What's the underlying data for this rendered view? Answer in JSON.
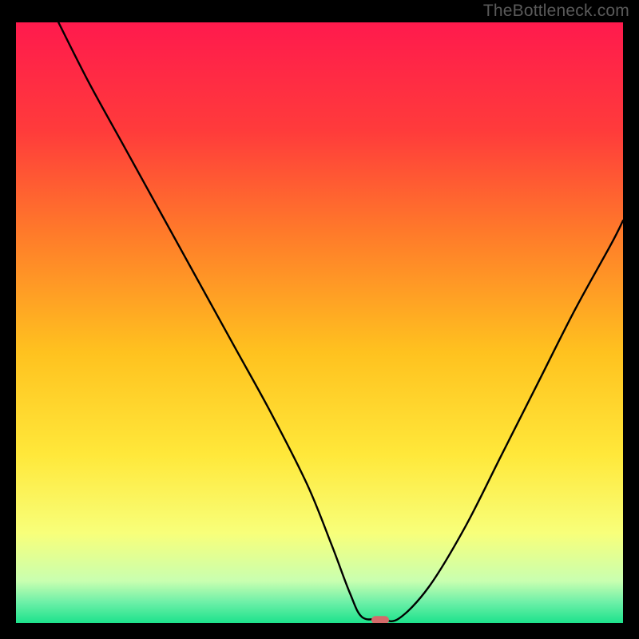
{
  "watermark": "TheBottleneck.com",
  "chart_data": {
    "type": "line",
    "title": "",
    "xlabel": "",
    "ylabel": "",
    "xlim": [
      0,
      100
    ],
    "ylim": [
      0,
      100
    ],
    "grid": false,
    "legend": false,
    "series": [
      {
        "name": "bottleneck-curve",
        "x": [
          7,
          12,
          18,
          24,
          30,
          36,
          42,
          48,
          52,
          55,
          57,
          60,
          63,
          68,
          74,
          80,
          86,
          92,
          98,
          100
        ],
        "values": [
          100,
          90,
          79,
          68,
          57,
          46,
          35,
          23,
          13,
          5,
          1,
          0.7,
          0.7,
          6,
          16,
          28,
          40,
          52,
          63,
          67
        ],
        "color": "#000000"
      }
    ],
    "marker": {
      "name": "optimum-marker",
      "x": 60,
      "y": 0.5,
      "color": "#d46a6a",
      "shape": "pill"
    },
    "background": {
      "type": "vertical-gradient",
      "stops": [
        {
          "pos": 0.0,
          "color": "#ff1a4d"
        },
        {
          "pos": 0.18,
          "color": "#ff3b3b"
        },
        {
          "pos": 0.35,
          "color": "#ff7a2a"
        },
        {
          "pos": 0.55,
          "color": "#ffc21f"
        },
        {
          "pos": 0.72,
          "color": "#ffe83a"
        },
        {
          "pos": 0.85,
          "color": "#f8ff7a"
        },
        {
          "pos": 0.93,
          "color": "#c9ffb0"
        },
        {
          "pos": 0.965,
          "color": "#6ef0a8"
        },
        {
          "pos": 1.0,
          "color": "#1de28c"
        }
      ]
    }
  }
}
